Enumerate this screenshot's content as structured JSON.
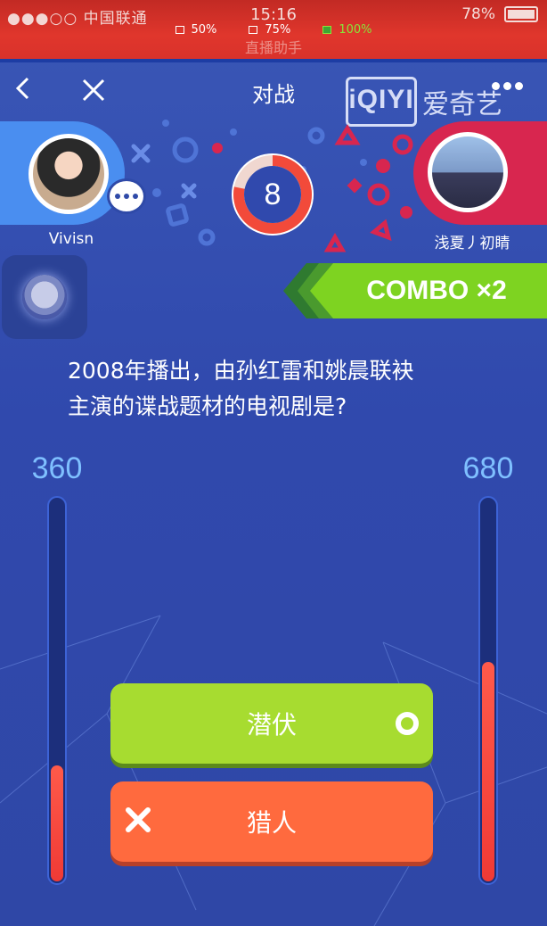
{
  "status_bar": {
    "carrier": "●●●○○ 中国联通",
    "time": "15:16",
    "battery": "78%",
    "faded_title": "直播助手"
  },
  "zoom_options": [
    {
      "label": "50%",
      "active": false
    },
    {
      "label": "75%",
      "active": false
    },
    {
      "label": "100%",
      "active": true
    }
  ],
  "nav": {
    "title": "对战",
    "logo_box": "iQIYI",
    "logo_text": "爱奇艺"
  },
  "players": {
    "left": {
      "name": "Vivisn",
      "score": "360",
      "score_fraction": 0.3
    },
    "right": {
      "name": "浅夏丿初睛",
      "score": "680",
      "score_fraction": 0.57
    }
  },
  "timer": {
    "value": "8",
    "fraction": 0.78
  },
  "combo": {
    "label": "COMBO ×2"
  },
  "question": {
    "line1": "2008年播出，由孙红雷和姚晨联袂",
    "line2": "主演的谍战题材的电视剧是?"
  },
  "answers": [
    {
      "label": "潜伏",
      "mark": "circle-icon"
    },
    {
      "label": "猎人",
      "mark": "cross-icon"
    }
  ],
  "colors": {
    "background": "#3049ad",
    "status_red": "#e0362c",
    "left_player": "#4a8ef0",
    "right_player": "#d8264f",
    "combo_green": "#7ed321",
    "answer_green": "#a7dc30",
    "answer_orange": "#ff6a3e",
    "score_blue": "#7fc0ff",
    "bar_fill": "#f03a35"
  }
}
